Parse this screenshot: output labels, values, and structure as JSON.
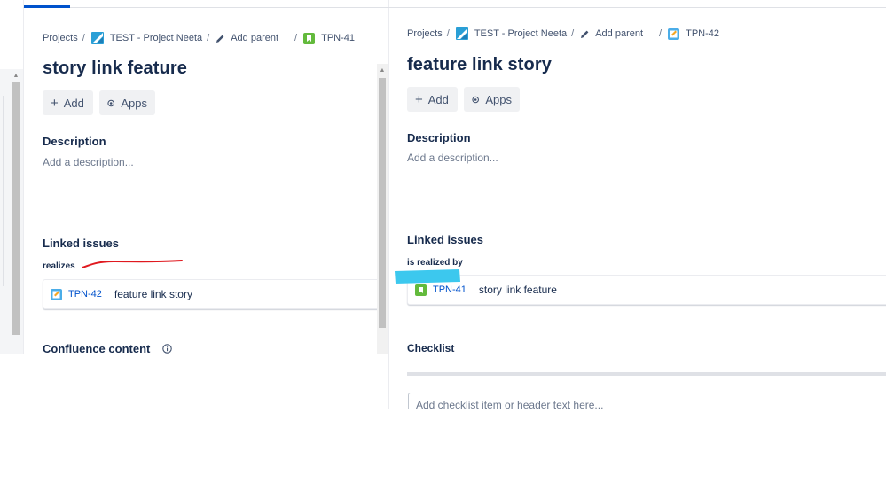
{
  "left": {
    "breadcrumbs": {
      "projects": "Projects",
      "project": "TEST - Project Neeta",
      "add_parent": "Add parent",
      "issue_key": "TPN-41"
    },
    "title": "story link feature",
    "buttons": {
      "add": "Add",
      "apps": "Apps"
    },
    "description": {
      "heading": "Description",
      "placeholder": "Add a description..."
    },
    "linked_issues": {
      "heading": "Linked issues",
      "link_type": "realizes",
      "items": [
        {
          "key": "TPN-42",
          "summary": "feature link story",
          "type": "task"
        }
      ]
    },
    "confluence": {
      "heading": "Confluence content"
    }
  },
  "right": {
    "breadcrumbs": {
      "projects": "Projects",
      "project": "TEST - Project Neeta",
      "add_parent": "Add parent",
      "issue_key": "TPN-42"
    },
    "title": "feature link story",
    "buttons": {
      "add": "Add",
      "apps": "Apps"
    },
    "description": {
      "heading": "Description",
      "placeholder": "Add a description..."
    },
    "linked_issues": {
      "heading": "Linked issues",
      "link_type": "is realized by",
      "items": [
        {
          "key": "TPN-41",
          "summary": "story link feature",
          "type": "story"
        }
      ]
    },
    "checklist": {
      "heading": "Checklist",
      "placeholder": "Add checklist item or header text here..."
    }
  },
  "colors": {
    "link": "#0052cc",
    "story_icon": "#63ba3c",
    "task_icon": "#4bade8",
    "annotation_red": "#e0191f",
    "annotation_blue": "#3cc8ee"
  },
  "icons": [
    "project-icon",
    "pencil-icon",
    "story-icon",
    "task-icon",
    "plus-icon",
    "apps-icon",
    "info-icon"
  ]
}
